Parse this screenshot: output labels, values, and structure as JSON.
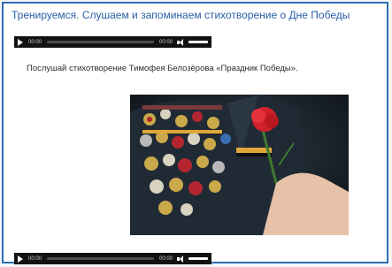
{
  "lesson": {
    "title": "Тренируемся. Слушаем и запоминаем стихотворение о Дне Победы",
    "instruction": "Послушай стихотворение Тимофея Белозёрова «Праздник Победы»."
  },
  "players": [
    {
      "current_time": "00:00",
      "duration": "00:00"
    },
    {
      "current_time": "00:00",
      "duration": "00:00"
    }
  ],
  "colors": {
    "frame_border": "#2d6fb5",
    "title_text": "#2a5fa5",
    "player_bg": "#121212"
  },
  "icons": [
    "play-icon",
    "volume-icon"
  ],
  "image": {
    "subject": "veteran-medals-red-carnation-photo"
  }
}
